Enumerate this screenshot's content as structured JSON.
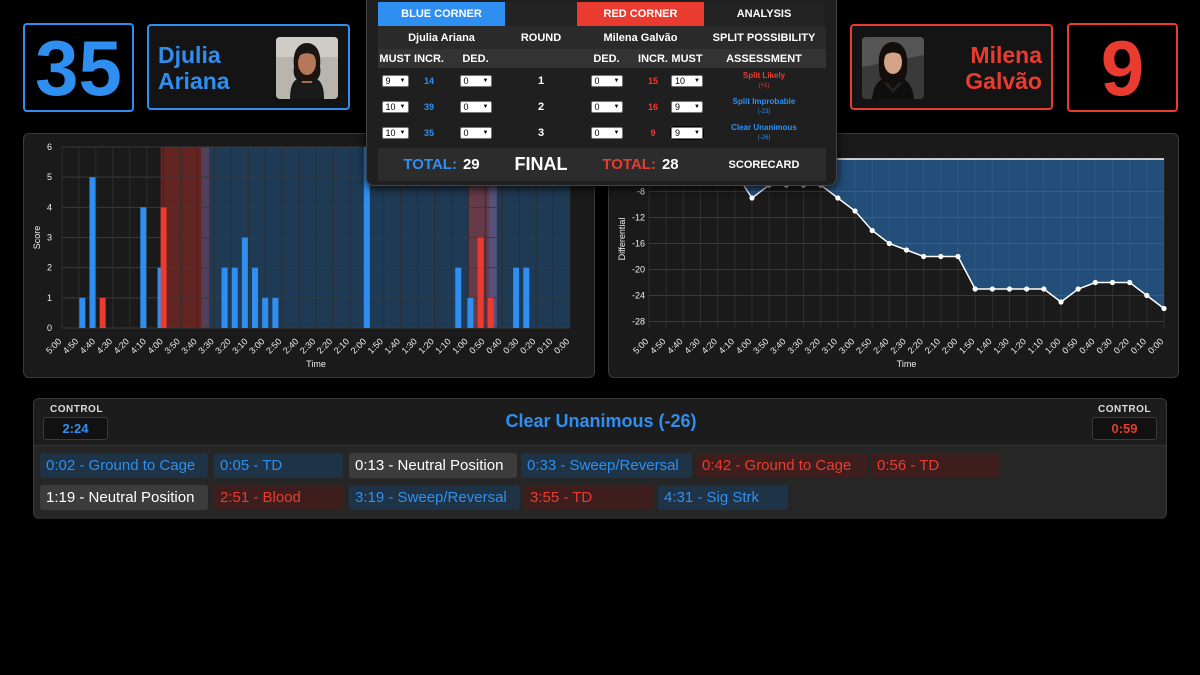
{
  "blue": {
    "score": "35",
    "first_name": "Djulia",
    "last_name": "Ariana"
  },
  "red": {
    "score": "9",
    "first_name": "Milena",
    "last_name": "Galvão"
  },
  "scorecard": {
    "header": {
      "blue_corner": "BLUE CORNER",
      "red_corner": "RED CORNER",
      "analysis": "ANALYSIS",
      "blue_name": "Djulia Ariana",
      "round": "ROUND",
      "red_name": "Milena Galvão",
      "split_possibility": "SPLIT POSSIBILITY"
    },
    "columns": {
      "must": "MUST",
      "incr": "INCR.",
      "ded": "DED.",
      "assessment": "ASSESSMENT"
    },
    "rounds": [
      {
        "round": "1",
        "blue_must": "9",
        "blue_incr": "14",
        "blue_ded": "0",
        "red_ded": "0",
        "red_incr": "15",
        "red_must": "10",
        "assessment": "Split Likely",
        "assessment_sub": "(+1)",
        "assessment_color": "#ea3b30"
      },
      {
        "round": "2",
        "blue_must": "10",
        "blue_incr": "39",
        "blue_ded": "0",
        "red_ded": "0",
        "red_incr": "16",
        "red_must": "9",
        "assessment": "Split Improbable",
        "assessment_sub": "(-23)",
        "assessment_color": "#2f8ff0"
      },
      {
        "round": "3",
        "blue_must": "10",
        "blue_incr": "35",
        "blue_ded": "0",
        "red_ded": "0",
        "red_incr": "9",
        "red_must": "9",
        "assessment": "Clear Unanimous",
        "assessment_sub": "(-26)",
        "assessment_color": "#2f8ff0"
      }
    ],
    "total_label": "TOTAL:",
    "blue_total": "29",
    "final": "FINAL",
    "red_total": "28",
    "scorecard_label": "SCORECARD"
  },
  "chart_data": [
    {
      "type": "bar",
      "xlabel": "Time",
      "ylabel": "Score",
      "ylim": [
        0,
        6
      ],
      "x_ticks": [
        "5:00",
        "4:50",
        "4:40",
        "4:30",
        "4:20",
        "4:10",
        "4:00",
        "3:50",
        "3:40",
        "3:30",
        "3:20",
        "3:10",
        "3:00",
        "2:50",
        "2:40",
        "2:30",
        "2:20",
        "2:10",
        "2:00",
        "1:50",
        "1:40",
        "1:30",
        "1:20",
        "1:10",
        "1:00",
        "0:50",
        "0:40",
        "0:30",
        "0:20",
        "0:10",
        "0:00"
      ],
      "series": [
        {
          "color": "#2f8ff0",
          "points": [
            [
              4.8,
              1
            ],
            [
              4.7,
              5
            ],
            [
              4.2,
              4
            ],
            [
              4.03,
              2
            ],
            [
              3.4,
              2
            ],
            [
              3.3,
              2
            ],
            [
              3.2,
              3
            ],
            [
              3.1,
              2
            ],
            [
              3.0,
              1
            ],
            [
              2.9,
              1
            ],
            [
              2.0,
              6
            ],
            [
              1.1,
              2
            ],
            [
              0.98,
              1
            ],
            [
              0.53,
              2
            ],
            [
              0.43,
              2
            ]
          ]
        },
        {
          "color": "#ea3b30",
          "points": [
            [
              4.6,
              1
            ],
            [
              4.0,
              4
            ],
            [
              0.88,
              3
            ],
            [
              0.78,
              1
            ]
          ]
        }
      ],
      "ranges": [
        {
          "from": 4.03,
          "to": 3.63,
          "color": "red"
        },
        {
          "from": 3.63,
          "to": 3.55,
          "color": "mauve"
        },
        {
          "from": 3.55,
          "to": 0.0,
          "color": "blue"
        },
        {
          "from": 1.0,
          "to": 0.8,
          "color": "red"
        },
        {
          "from": 0.8,
          "to": 0.72,
          "color": "mauve"
        }
      ]
    },
    {
      "type": "area",
      "xlabel": "Time",
      "ylabel": "Differential",
      "y_ticks": [
        -28,
        -24,
        -20,
        -16,
        -12,
        -8
      ],
      "x_ticks": [
        "5:00",
        "4:50",
        "4:40",
        "4:30",
        "4:20",
        "4:10",
        "4:00",
        "3:50",
        "3:40",
        "3:30",
        "3:20",
        "3:10",
        "3:00",
        "2:50",
        "2:40",
        "2:30",
        "2:20",
        "2:10",
        "2:00",
        "1:50",
        "1:40",
        "1:30",
        "1:20",
        "1:10",
        "1:00",
        "0:50",
        "0:40",
        "0:30",
        "0:20",
        "0:10",
        "0:00"
      ],
      "x": [
        "4:30",
        "4:20",
        "4:10",
        "4:00",
        "3:50",
        "3:40",
        "3:30",
        "3:20",
        "3:10",
        "3:00",
        "2:50",
        "2:40",
        "2:30",
        "2:20",
        "2:10",
        "2:00",
        "1:50",
        "1:40",
        "1:30",
        "1:20",
        "1:10",
        "1:00",
        "0:50",
        "0:40",
        "0:30",
        "0:20",
        "0:10",
        "0:00"
      ],
      "values": [
        -6,
        -5,
        -5,
        -9,
        -7,
        -7,
        -7,
        -7,
        -9,
        -11,
        -14,
        -16,
        -17,
        -18,
        -18,
        -18,
        -23,
        -23,
        -23,
        -23,
        -23,
        -25,
        -23,
        -22,
        -22,
        -22,
        -24,
        -26
      ]
    }
  ],
  "bottom": {
    "control_label": "CONTROL",
    "blue_control": "2:24",
    "red_control": "0:59",
    "verdict": "Clear Unanimous (-26)",
    "events_row1": [
      {
        "text": "0:02 - Ground to Cage",
        "side": "blue"
      },
      {
        "text": "0:05 - TD",
        "side": "blue"
      },
      {
        "text": "0:13 - Neutral Position",
        "side": "neutral"
      },
      {
        "text": "0:33 - Sweep/Reversal",
        "side": "blue"
      },
      {
        "text": "0:42 - Ground to Cage",
        "side": "red"
      },
      {
        "text": "0:56 - TD",
        "side": "red"
      }
    ],
    "events_row2": [
      {
        "text": "1:19 - Neutral Position",
        "side": "neutral"
      },
      {
        "text": "2:51 - Blood",
        "side": "red"
      },
      {
        "text": "3:19 - Sweep/Reversal",
        "side": "blue"
      },
      {
        "text": "3:55 - TD",
        "side": "red"
      },
      {
        "text": "4:31 - Sig Strk",
        "side": "blue"
      }
    ]
  }
}
